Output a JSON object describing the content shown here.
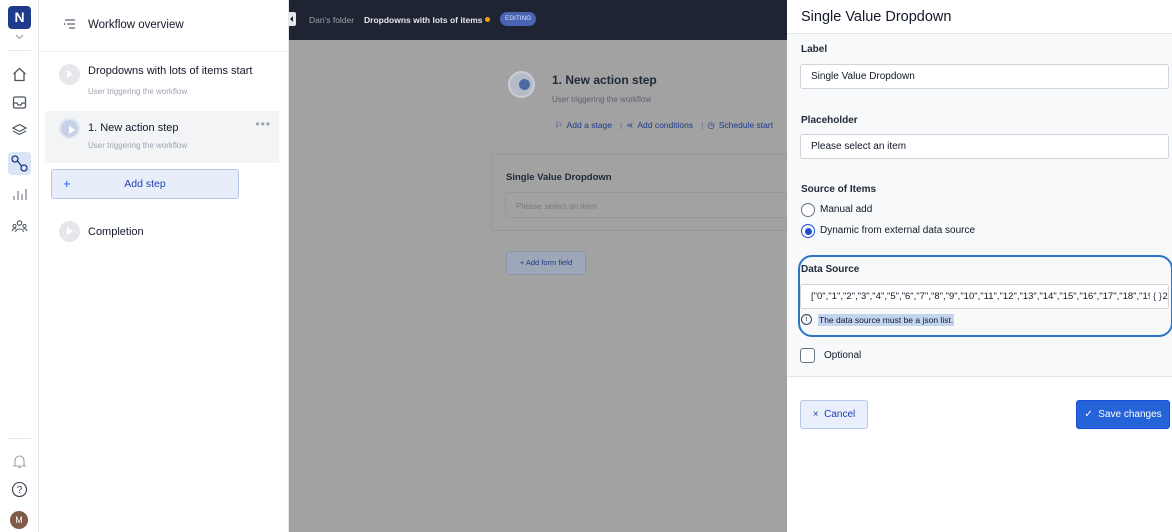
{
  "rail": {
    "logo": "N",
    "avatar": "M"
  },
  "steps_panel": {
    "overview_title": "Workflow overview",
    "steps": [
      {
        "title": "Dropdowns with lots of items start",
        "subtitle": "User triggering the workflow"
      },
      {
        "title": "1. New action step",
        "subtitle": "User triggering the workflow",
        "more": "•••"
      }
    ],
    "add_step": {
      "plus": "+",
      "label": "Add step"
    },
    "completion": "Completion"
  },
  "topbar": {
    "crumb_folder": "Dan's folder",
    "crumb_page": "Dropdowns with lots of items",
    "badge": "EDITING"
  },
  "canvas": {
    "node_title": "1. New action step",
    "node_subtitle": "User triggering the workflow",
    "actions": {
      "add_stage": "Add a stage",
      "add_conditions": "Add conditions",
      "schedule_start": "Schedule start"
    },
    "form_field_label": "Single Value Dropdown",
    "form_field_placeholder": "Please select an item",
    "add_form_field": "+  Add form field"
  },
  "panel": {
    "title": "Single Value Dropdown",
    "label": {
      "label": "Label",
      "value": "Single Value Dropdown"
    },
    "placeholder": {
      "label": "Placeholder",
      "value": "Please select an item"
    },
    "source": {
      "label": "Source of Items",
      "options": [
        "Manual add",
        "Dynamic from external data source"
      ],
      "selected": "Dynamic from external data source"
    },
    "data_source": {
      "label": "Data Source",
      "value": "[\"0\",\"1\",\"2\",\"3\",\"4\",\"5\",\"6\",\"7\",\"8\",\"9\",\"10\",\"11\",\"12\",\"13\",\"14\",\"15\",\"16\",\"17\",\"18\",\"19\",\"2",
      "braces": "{ }",
      "info_icon": "i",
      "hint": "The data source must be a json list."
    },
    "optional_label": "Optional",
    "cancel": "Cancel",
    "save": "Save changes"
  },
  "colors": {
    "primary": "#2563d8",
    "dark_topbar": "#1e2431",
    "canvas_overlay": "#a2a2a2",
    "highlight_border": "#2e74c4"
  }
}
